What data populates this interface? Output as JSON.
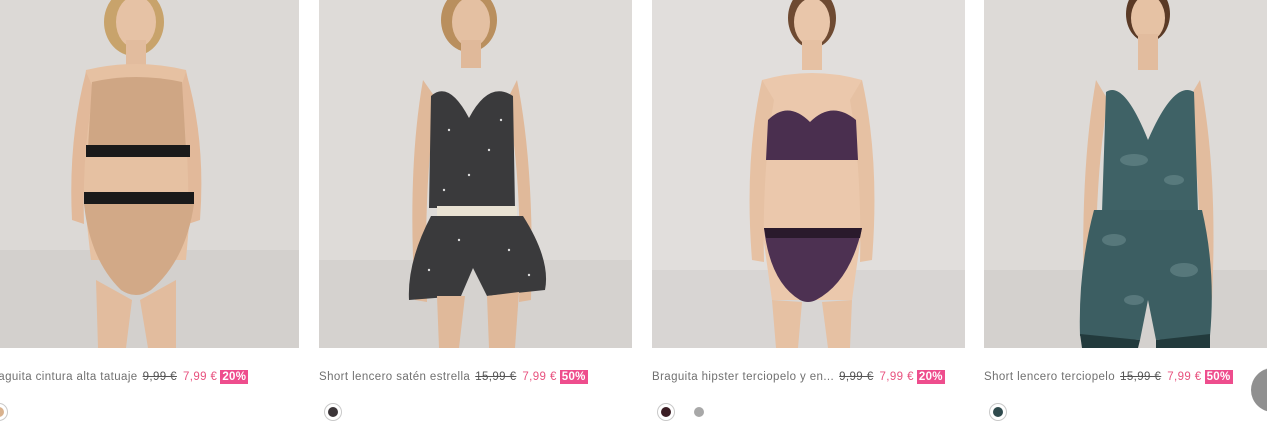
{
  "products": [
    {
      "name": "Braguita cintura alta tatuaje",
      "old_price": "9,99 €",
      "new_price": "7,99 €",
      "discount": "20%",
      "swatches": [
        {
          "color": "#d9b28e"
        }
      ]
    },
    {
      "name": "Short lencero satén estrella",
      "old_price": "15,99 €",
      "new_price": "7,99 €",
      "discount": "50%",
      "swatches": [
        {
          "color": "#3b3538"
        }
      ]
    },
    {
      "name": "Braguita hipster terciopelo y en...",
      "old_price": "9,99 €",
      "new_price": "7,99 €",
      "discount": "20%",
      "swatches": [
        {
          "color": "#3a1d24"
        },
        {
          "color": "#a8a8a8"
        }
      ]
    },
    {
      "name": "Short lencero terciopelo",
      "old_price": "15,99 €",
      "new_price": "7,99 €",
      "discount": "50%",
      "swatches": [
        {
          "color": "#2f4a4d"
        }
      ]
    }
  ],
  "colors": {
    "price_sale": "#e8527f",
    "badge_bg": "#ee4d8d",
    "text": "#707070"
  }
}
